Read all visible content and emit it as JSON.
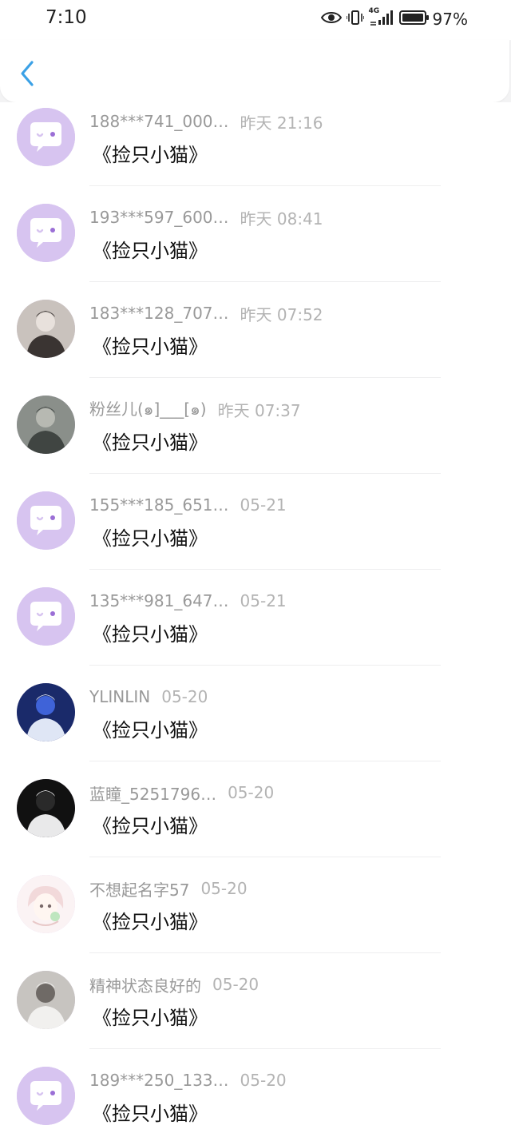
{
  "status_bar": {
    "time": "7:10",
    "battery": "97%",
    "network": "4G"
  },
  "colors": {
    "accent": "#3ba1e6",
    "default_avatar": "#d7c4f0"
  },
  "list": [
    {
      "username": "188***741_000…",
      "time": "昨天 21:16",
      "message": "《捡只小猫》",
      "avatar": "default-chat-avatar"
    },
    {
      "username": "193***597_600…",
      "time": "昨天 08:41",
      "message": "《捡只小猫》",
      "avatar": "default-chat-avatar"
    },
    {
      "username": "183***128_707…",
      "time": "昨天 07:52",
      "message": "《捡只小猫》",
      "avatar": "photo-avatar"
    },
    {
      "username": "粉丝儿(๑]___[๑)",
      "time": "昨天 07:37",
      "message": "《捡只小猫》",
      "avatar": "photo-avatar"
    },
    {
      "username": "155***185_651…",
      "time": "05-21",
      "message": "《捡只小猫》",
      "avatar": "default-chat-avatar"
    },
    {
      "username": "135***981_647…",
      "time": "05-21",
      "message": "《捡只小猫》",
      "avatar": "default-chat-avatar"
    },
    {
      "username": "YLINLIN",
      "time": "05-20",
      "message": "《捡只小猫》",
      "avatar": "photo-avatar"
    },
    {
      "username": "蓝瞳_5251796…",
      "time": "05-20",
      "message": "《捡只小猫》",
      "avatar": "photo-avatar"
    },
    {
      "username": "不想起名字57",
      "time": "05-20",
      "message": "《捡只小猫》",
      "avatar": "illustration-avatar"
    },
    {
      "username": "精神状态良好的",
      "time": "05-20",
      "message": "《捡只小猫》",
      "avatar": "photo-avatar"
    },
    {
      "username": "189***250_133…",
      "time": "05-20",
      "message": "《捡只小猫》",
      "avatar": "default-chat-avatar"
    }
  ]
}
